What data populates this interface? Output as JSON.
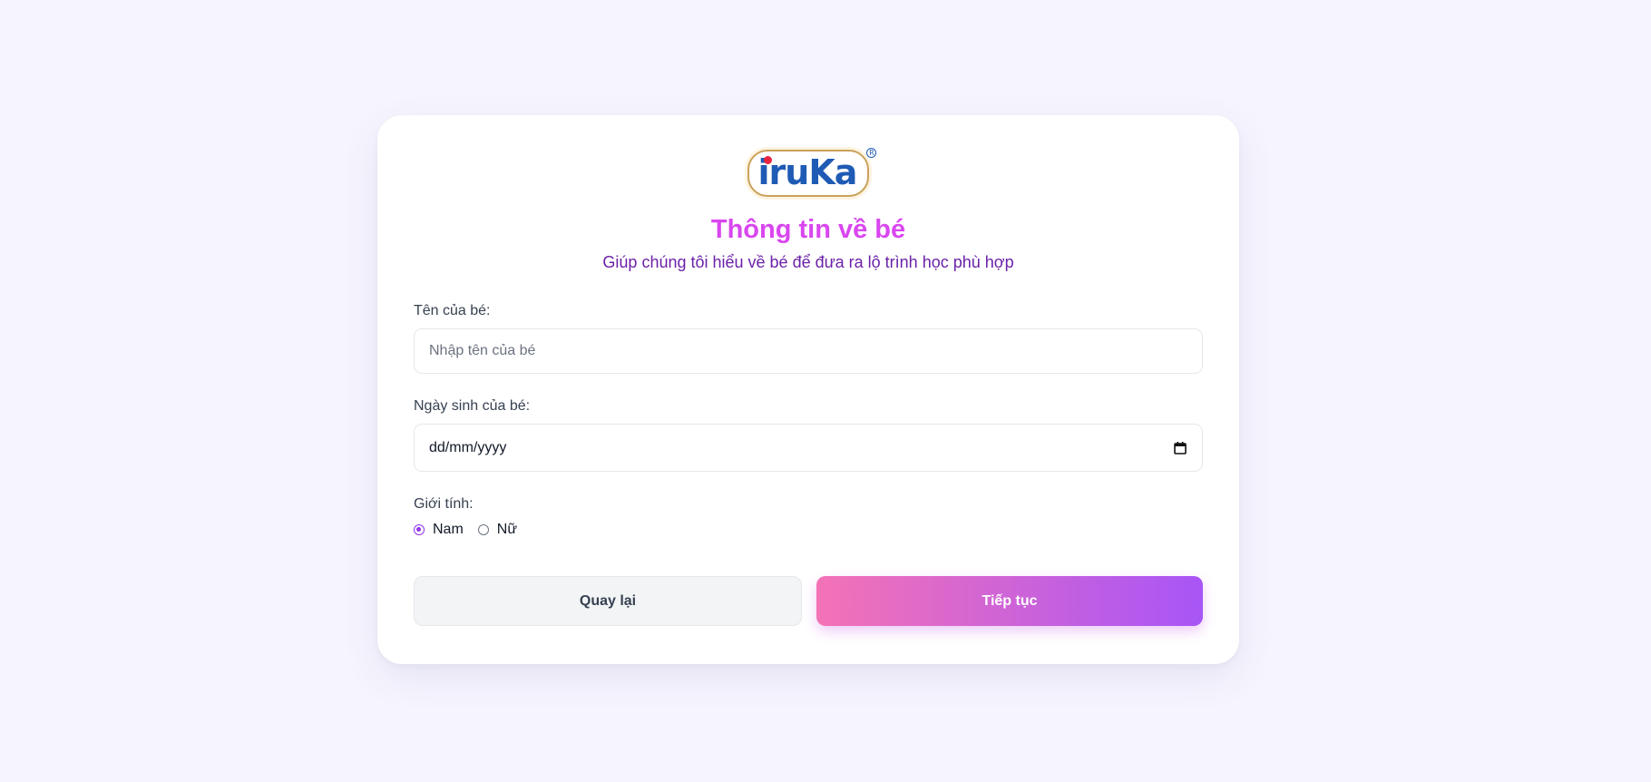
{
  "logo": {
    "text": "iruKa",
    "reg_mark": "R"
  },
  "header": {
    "title": "Thông tin về bé",
    "subtitle": "Giúp chúng tôi hiểu về bé để đưa ra lộ trình học phù hợp"
  },
  "form": {
    "name": {
      "label": "Tên của bé:",
      "placeholder": "Nhập tên của bé",
      "value": ""
    },
    "dob": {
      "label": "Ngày sinh của bé:",
      "value": "dd/mm/yyyy",
      "icon": "calendar-icon"
    },
    "gender": {
      "label": "Giới tính:",
      "options": [
        {
          "label": "Nam",
          "checked": true
        },
        {
          "label": "Nữ",
          "checked": false
        }
      ]
    }
  },
  "buttons": {
    "back_label": "Quay lại",
    "next_label": "Tiếp tục"
  },
  "colors": {
    "background": "#f6f5fe",
    "title": "#d946ef",
    "subtitle": "#6b21a8",
    "accent": "#9333ea",
    "gradient_start": "#f472b6",
    "gradient_end": "#a855f7"
  }
}
